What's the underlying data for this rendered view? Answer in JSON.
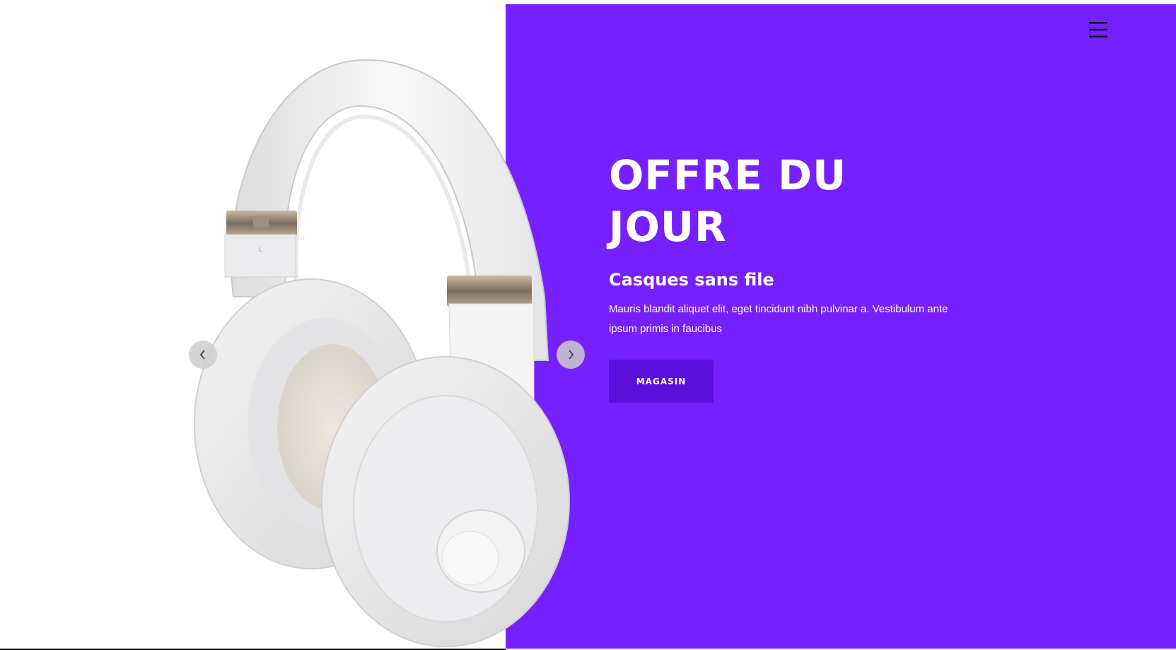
{
  "hero": {
    "title_line1": "OFFRE DU",
    "title_line2": "JOUR",
    "subtitle": "Casques sans file",
    "description": "Mauris blandit aliquet elit, eget tincidunt nibh pulvinar a. Vestibulum ante ipsum primis in faucibus",
    "button_label": "MAGASIN"
  },
  "icons": {
    "menu": "hamburger-menu-icon",
    "prev": "chevron-left-icon",
    "next": "chevron-right-icon"
  },
  "colors": {
    "panel": "#7720ff",
    "button": "#5b0fdc",
    "text": "#ffffff"
  }
}
